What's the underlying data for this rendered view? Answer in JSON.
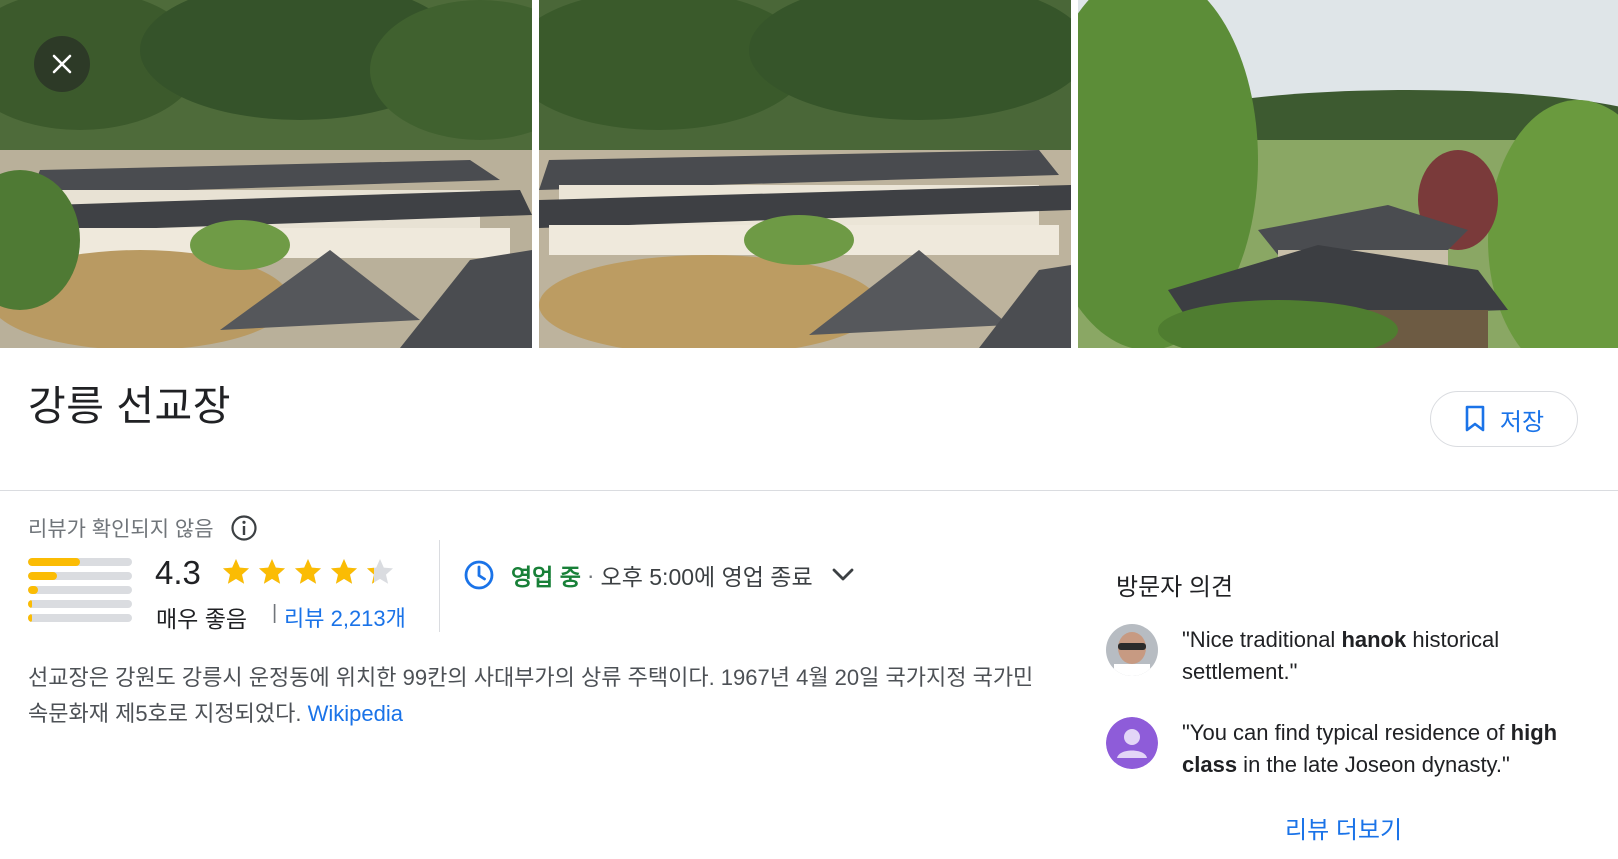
{
  "header": {
    "close_icon": "close-icon"
  },
  "photos": [
    {
      "name": "photo-1",
      "alt": ""
    },
    {
      "name": "photo-2",
      "alt": ""
    },
    {
      "name": "photo-3",
      "alt": ""
    }
  ],
  "place": {
    "title": "강릉 선교장",
    "save_label": "저장",
    "save_icon": "bookmark-icon"
  },
  "rating": {
    "unverified_label": "리뷰가 확인되지 않음",
    "info_icon": "info-icon",
    "score": "4.3",
    "score_value": 4.3,
    "rating_word": "매우 좋음",
    "separator": "|",
    "reviews_link": "리뷰 2,213개",
    "distribution": [
      0.5,
      0.28,
      0.1,
      0.04,
      0.04
    ],
    "star_color": "#fbbc04"
  },
  "hours": {
    "icon": "clock-icon",
    "status": "영업 중",
    "dot": "·",
    "close_text": "오후 5:00에 영업 종료",
    "expand_icon": "chevron-down-icon"
  },
  "description": {
    "text": "선교장은 강원도 강릉시 운정동에 위치한 99칸의 사대부가의 상류 주택이다. 1967년 4월 20일 국가지정 국가민속문화재 제5호로 지정되었다.",
    "source": "Wikipedia"
  },
  "reviews": {
    "title": "방문자 의견",
    "items": [
      {
        "q_open": "\"Nice traditional ",
        "bold": "hanok",
        "q_close": " historical settlement.\""
      },
      {
        "q_open": "\"You can find typical residence of ",
        "bold": "high class",
        "q_close": " in the late Joseon dynasty.\""
      }
    ],
    "more_label": "리뷰 더보기"
  },
  "colors": {
    "accent": "#1a73e8",
    "open": "#188038",
    "star": "#fbbc04"
  }
}
